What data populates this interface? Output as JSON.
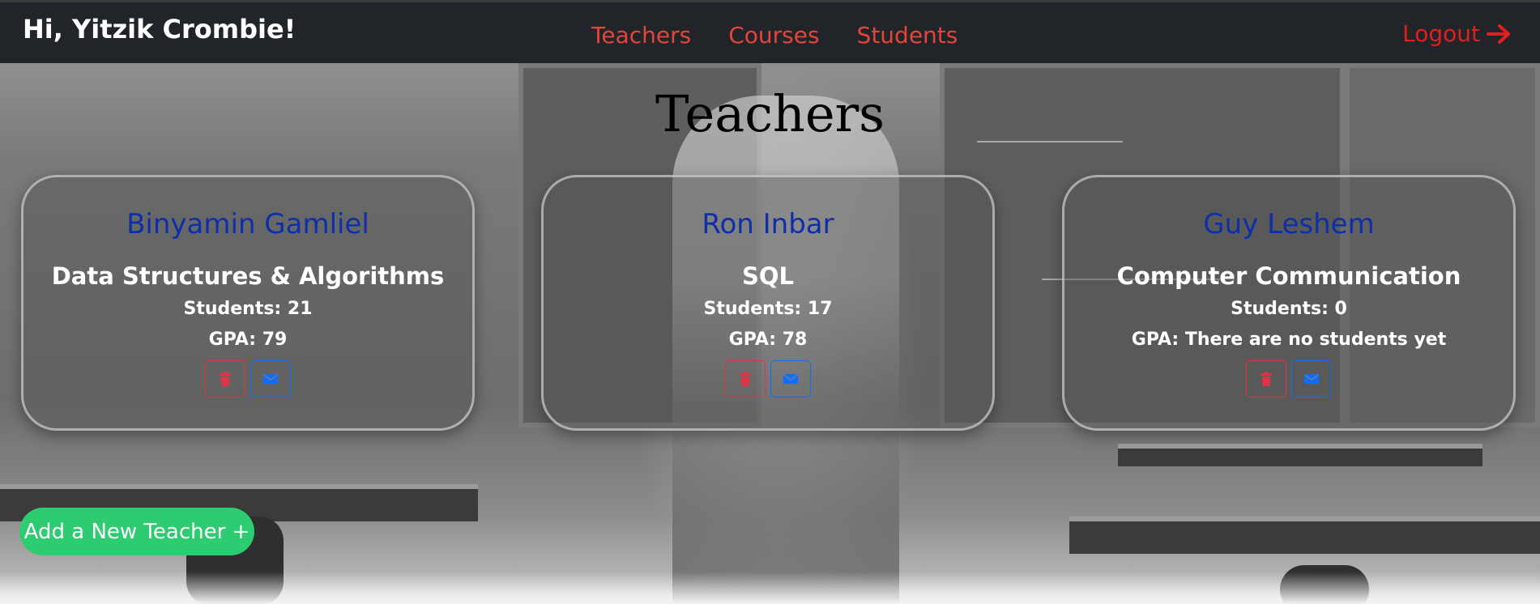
{
  "navbar": {
    "greeting": "Hi, Yitzik Crombie!",
    "links": [
      "Teachers",
      "Courses",
      "Students"
    ],
    "logout_label": "Logout",
    "logout_icon": "arrow-right-icon",
    "link_color": "#e4453a",
    "logout_color": "#e01f1f"
  },
  "page": {
    "title": "Teachers"
  },
  "teachers": [
    {
      "name": "Binyamin Gamliel",
      "course": "Data Structures & Algorithms",
      "students_text": "Students: 21",
      "gpa_text": "GPA: 79"
    },
    {
      "name": "Ron Inbar",
      "course": "SQL",
      "students_text": "Students: 17",
      "gpa_text": "GPA: 78"
    },
    {
      "name": "Guy Leshem",
      "course": "Computer Communication",
      "students_text": "Students: 0",
      "gpa_text": "GPA: There are no students yet"
    }
  ],
  "card_actions": {
    "delete_icon": "trash-icon",
    "mail_icon": "envelope-icon",
    "delete_color": "#dc3545",
    "mail_color": "#0d6efd"
  },
  "add_button": {
    "label": "Add a New Teacher +",
    "color": "#2ecc71"
  },
  "colors": {
    "navbar_bg": "#212529",
    "teacher_name": "#0d2fa8"
  }
}
